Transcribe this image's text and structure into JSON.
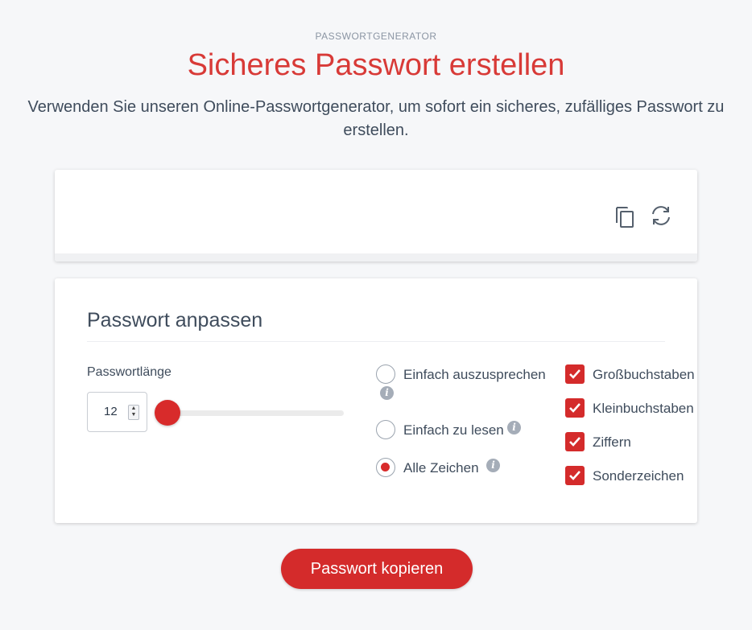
{
  "header": {
    "eyebrow": "PASSWORTGENERATOR",
    "title": "Sicheres Passwort erstellen",
    "subtitle": "Verwenden Sie unseren Online-Passwortgenerator, um sofort ein sicheres, zufälliges Passwort zu erstellen."
  },
  "output": {
    "password": "",
    "copy_icon": "copy-icon",
    "refresh_icon": "refresh-icon"
  },
  "settings": {
    "title": "Passwort anpassen",
    "length_label": "Passwortlänge",
    "length_value": "12",
    "slider_fraction": 0.0,
    "char_modes": [
      {
        "label": "Einfach auszusprechen",
        "checked": false
      },
      {
        "label": "Einfach zu lesen",
        "checked": false
      },
      {
        "label": "Alle Zeichen",
        "checked": true
      }
    ],
    "char_types": [
      {
        "label": "Großbuchstaben",
        "checked": true
      },
      {
        "label": "Kleinbuchstaben",
        "checked": true
      },
      {
        "label": "Ziffern",
        "checked": true
      },
      {
        "label": "Sonderzeichen",
        "checked": true
      }
    ]
  },
  "actions": {
    "copy_button": "Passwort kopieren"
  },
  "colors": {
    "accent": "#d42b2b",
    "title": "#d83a37",
    "text": "#3f4c5c"
  }
}
